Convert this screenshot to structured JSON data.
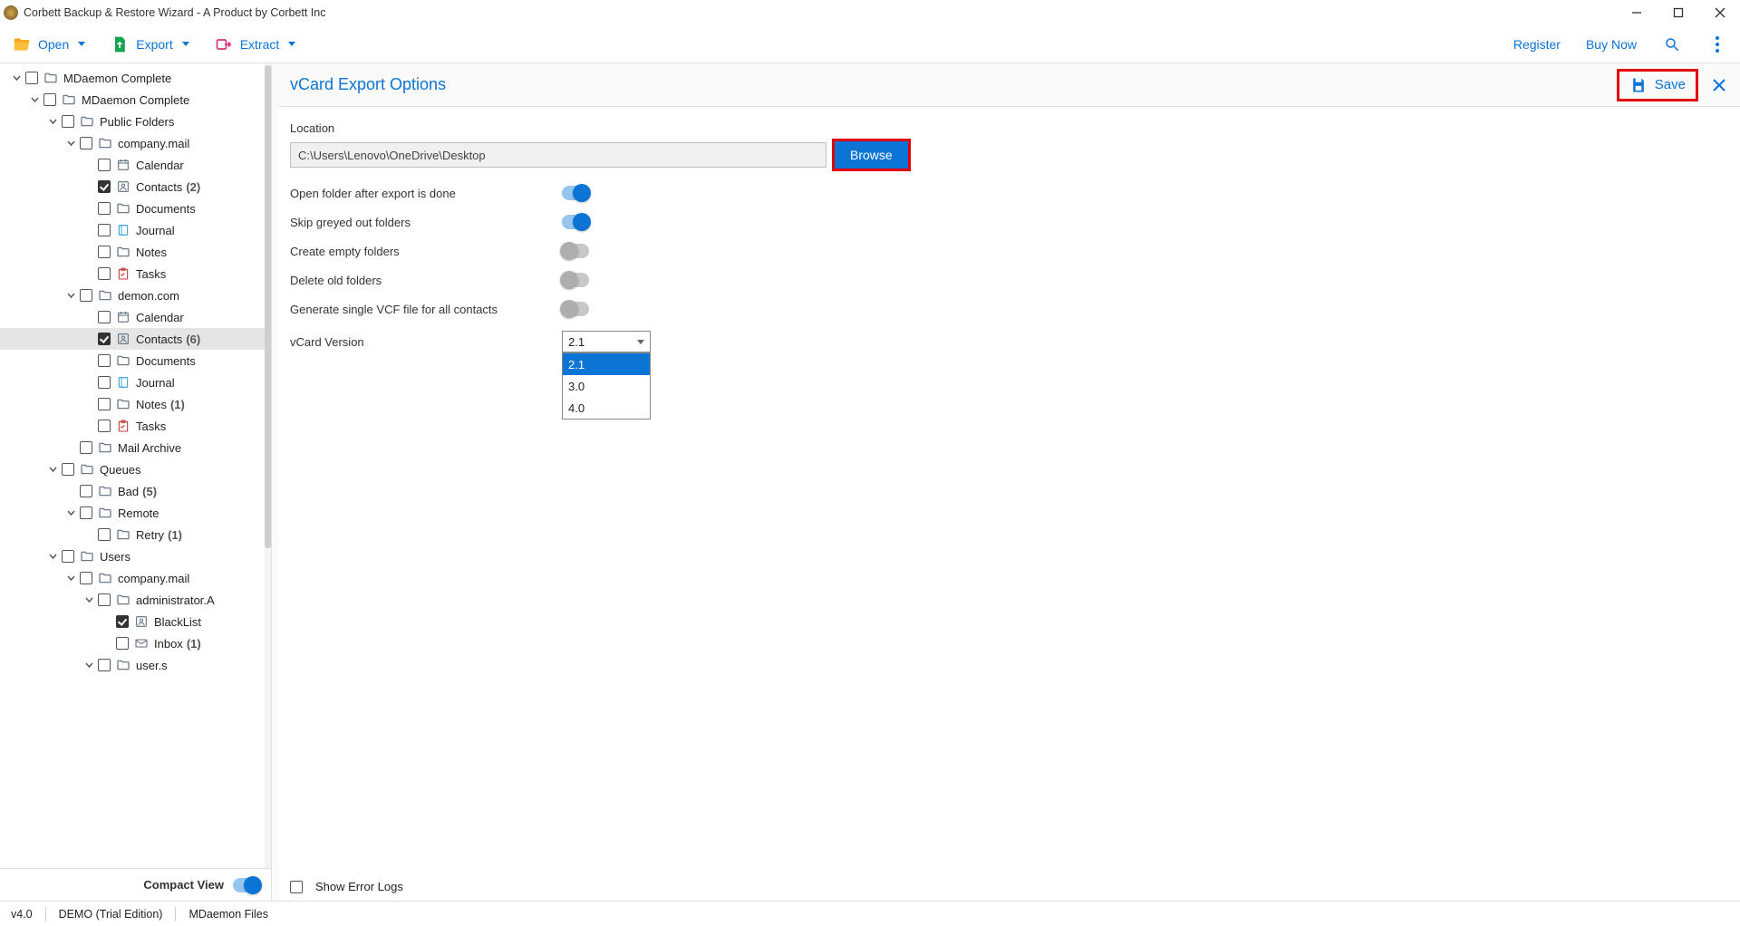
{
  "app": {
    "title": "Corbett Backup & Restore Wizard - A Product by Corbett Inc"
  },
  "toolbar": {
    "open": "Open",
    "export": "Export",
    "extract": "Extract",
    "register": "Register",
    "buynow": "Buy Now"
  },
  "sidebar": {
    "compact_view": "Compact View",
    "items": [
      {
        "indent": 0,
        "expander": "open",
        "checkbox": "unchecked",
        "icon": "folder",
        "label": "MDaemon Complete",
        "count": ""
      },
      {
        "indent": 1,
        "expander": "open",
        "checkbox": "unchecked",
        "icon": "folder",
        "label": "MDaemon Complete",
        "count": ""
      },
      {
        "indent": 2,
        "expander": "open",
        "checkbox": "unchecked",
        "icon": "folder",
        "label": "Public Folders",
        "count": ""
      },
      {
        "indent": 3,
        "expander": "open",
        "checkbox": "unchecked",
        "icon": "folder",
        "label": "company.mail",
        "count": ""
      },
      {
        "indent": 4,
        "expander": "none",
        "checkbox": "unchecked",
        "icon": "calendar",
        "label": "Calendar",
        "count": ""
      },
      {
        "indent": 4,
        "expander": "none",
        "checkbox": "checked",
        "icon": "contacts",
        "label": "Contacts",
        "count": "(2)"
      },
      {
        "indent": 4,
        "expander": "none",
        "checkbox": "unchecked",
        "icon": "folder",
        "label": "Documents",
        "count": ""
      },
      {
        "indent": 4,
        "expander": "none",
        "checkbox": "unchecked",
        "icon": "journal",
        "label": "Journal",
        "count": ""
      },
      {
        "indent": 4,
        "expander": "none",
        "checkbox": "unchecked",
        "icon": "folder",
        "label": "Notes",
        "count": ""
      },
      {
        "indent": 4,
        "expander": "none",
        "checkbox": "unchecked",
        "icon": "tasks",
        "label": "Tasks",
        "count": ""
      },
      {
        "indent": 3,
        "expander": "open",
        "checkbox": "unchecked",
        "icon": "folder",
        "label": "demon.com",
        "count": ""
      },
      {
        "indent": 4,
        "expander": "none",
        "checkbox": "unchecked",
        "icon": "calendar",
        "label": "Calendar",
        "count": ""
      },
      {
        "indent": 4,
        "expander": "none",
        "checkbox": "checked",
        "icon": "contacts",
        "label": "Contacts",
        "count": "(6)",
        "selected": true
      },
      {
        "indent": 4,
        "expander": "none",
        "checkbox": "unchecked",
        "icon": "folder",
        "label": "Documents",
        "count": ""
      },
      {
        "indent": 4,
        "expander": "none",
        "checkbox": "unchecked",
        "icon": "journal",
        "label": "Journal",
        "count": ""
      },
      {
        "indent": 4,
        "expander": "none",
        "checkbox": "unchecked",
        "icon": "folder",
        "label": "Notes",
        "count": "(1)"
      },
      {
        "indent": 4,
        "expander": "none",
        "checkbox": "unchecked",
        "icon": "tasks",
        "label": "Tasks",
        "count": ""
      },
      {
        "indent": 3,
        "expander": "none",
        "checkbox": "unchecked",
        "icon": "folder",
        "label": "Mail Archive",
        "count": ""
      },
      {
        "indent": 2,
        "expander": "open",
        "checkbox": "unchecked",
        "icon": "folder",
        "label": "Queues",
        "count": ""
      },
      {
        "indent": 3,
        "expander": "none",
        "checkbox": "unchecked",
        "icon": "folder",
        "label": "Bad",
        "count": "(5)"
      },
      {
        "indent": 3,
        "expander": "open",
        "checkbox": "unchecked",
        "icon": "folder",
        "label": "Remote",
        "count": ""
      },
      {
        "indent": 4,
        "expander": "none",
        "checkbox": "unchecked",
        "icon": "folder",
        "label": "Retry",
        "count": "(1)"
      },
      {
        "indent": 2,
        "expander": "open",
        "checkbox": "unchecked",
        "icon": "folder",
        "label": "Users",
        "count": ""
      },
      {
        "indent": 3,
        "expander": "open",
        "checkbox": "unchecked",
        "icon": "folder",
        "label": "company.mail",
        "count": ""
      },
      {
        "indent": 4,
        "expander": "open",
        "checkbox": "unchecked",
        "icon": "folder",
        "label": "administrator.A",
        "count": ""
      },
      {
        "indent": 5,
        "expander": "none",
        "checkbox": "checked",
        "icon": "contacts",
        "label": "BlackList",
        "count": ""
      },
      {
        "indent": 5,
        "expander": "none",
        "checkbox": "unchecked",
        "icon": "mail",
        "label": "Inbox",
        "count": "(1)"
      },
      {
        "indent": 4,
        "expander": "open",
        "checkbox": "unchecked",
        "icon": "folder",
        "label": "user.s",
        "count": ""
      }
    ]
  },
  "panel": {
    "title": "vCard Export Options",
    "save": "Save",
    "location_label": "Location",
    "location_value": "C:\\Users\\Lenovo\\OneDrive\\Desktop",
    "browse": "Browse",
    "options": [
      {
        "label": "Open folder after export is done",
        "on": true
      },
      {
        "label": "Skip greyed out folders",
        "on": true
      },
      {
        "label": "Create empty folders",
        "on": false
      },
      {
        "label": "Delete old folders",
        "on": false
      },
      {
        "label": "Generate single VCF file for all contacts",
        "on": false
      }
    ],
    "vcard_label": "vCard Version",
    "vcard_selected": "2.1",
    "vcard_options": [
      "2.1",
      "3.0",
      "4.0"
    ],
    "show_error_logs": "Show Error Logs"
  },
  "status": {
    "version": "v4.0",
    "edition": "DEMO (Trial Edition)",
    "filetype": "MDaemon Files"
  }
}
